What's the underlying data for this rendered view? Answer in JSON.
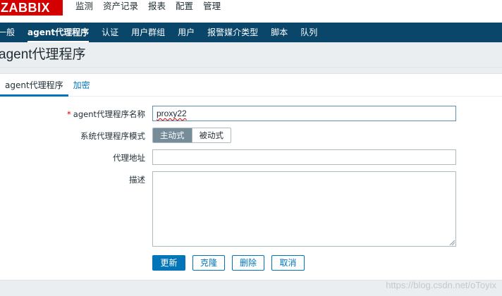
{
  "brand": {
    "logo_text": "ZABBIX",
    "accent": "#d40000",
    "nav_bg": "#0a466a",
    "link": "#0275b8"
  },
  "topmenu": [
    "监测",
    "资产记录",
    "报表",
    "配置",
    "管理"
  ],
  "topmenu_active": "管理",
  "submenu": [
    "一般",
    "agent代理程序",
    "认证",
    "用户群组",
    "用户",
    "报警媒介类型",
    "脚本",
    "队列"
  ],
  "submenu_active": "agent代理程序",
  "page_title": "agent代理程序",
  "tabs": [
    "agent代理程序",
    "加密"
  ],
  "form": {
    "name_label": "agent代理程序名称",
    "required_marker": "*",
    "name_value": "proxy22",
    "mode_label": "系统代理程序模式",
    "mode_options": [
      "主动式",
      "被动式"
    ],
    "mode_selected": "主动式",
    "address_label": "代理地址",
    "address_value": "",
    "description_label": "描述",
    "description_value": ""
  },
  "buttons": {
    "update": "更新",
    "clone": "克隆",
    "delete": "删除",
    "cancel": "取消"
  },
  "watermark": "https://blog.csdn.net/oToyix"
}
